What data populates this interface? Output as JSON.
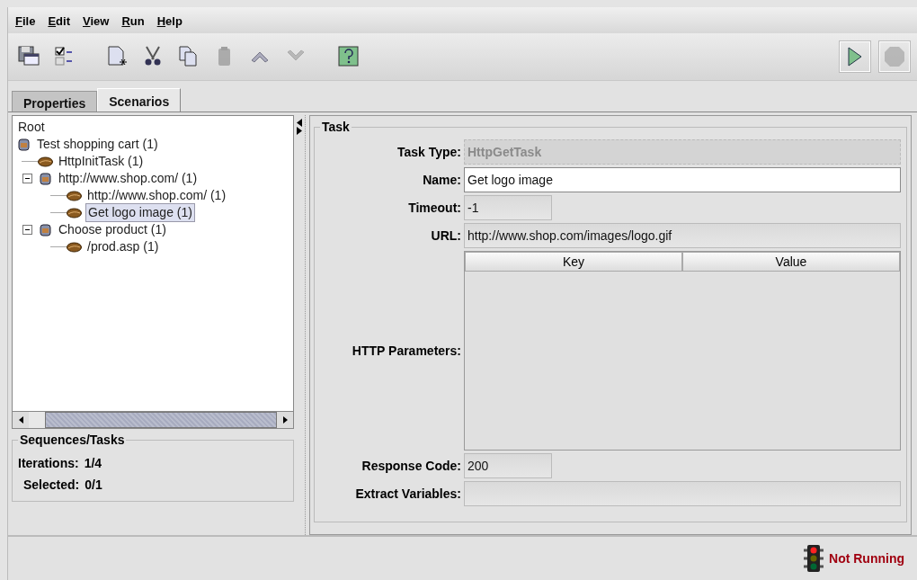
{
  "menu": [
    {
      "label": "File"
    },
    {
      "label": "Edit"
    },
    {
      "label": "View"
    },
    {
      "label": "Run"
    },
    {
      "label": "Help"
    }
  ],
  "toolbar": [
    {
      "kind": "save",
      "disabled": false
    },
    {
      "kind": "checklist",
      "disabled": false
    },
    {
      "kind": "sep"
    },
    {
      "kind": "new",
      "disabled": false
    },
    {
      "kind": "cut",
      "disabled": false
    },
    {
      "kind": "copy",
      "disabled": false
    },
    {
      "kind": "paste",
      "disabled": true
    },
    {
      "kind": "up",
      "disabled": false
    },
    {
      "kind": "down",
      "disabled": true
    },
    {
      "kind": "sep"
    },
    {
      "kind": "help",
      "disabled": false
    }
  ],
  "run_controls": [
    {
      "kind": "run",
      "disabled": false
    },
    {
      "kind": "stop",
      "disabled": true
    }
  ],
  "tabs": [
    {
      "label": "Properties",
      "selected": false
    },
    {
      "label": "Scenarios",
      "selected": true
    }
  ],
  "tree": {
    "root": "Root",
    "items": [
      {
        "label": "Test shopping cart (1)",
        "kind": "sequence",
        "selected": false,
        "children": [
          {
            "label": "HttpInitTask (1)",
            "kind": "task",
            "selected": false
          },
          {
            "label": "http://www.shop.com/ (1)",
            "kind": "sequence",
            "selected": false,
            "expanded": true,
            "children": [
              {
                "label": "http://www.shop.com/ (1)",
                "kind": "task",
                "selected": false
              },
              {
                "label": "Get logo image (1)",
                "kind": "task",
                "selected": true
              }
            ]
          },
          {
            "label": "Choose product (1)",
            "kind": "sequence",
            "selected": false,
            "expanded": true,
            "children": [
              {
                "label": "/prod.asp (1)",
                "kind": "task",
                "selected": false
              }
            ]
          }
        ]
      }
    ]
  },
  "sequences_panel": {
    "title": "Sequences/Tasks",
    "rows": [
      {
        "label": "Iterations:",
        "value": "1/4"
      },
      {
        "label": "Selected:",
        "value": "0/1"
      }
    ]
  },
  "task_panel": {
    "title": "Task",
    "fields": [
      {
        "label": "Task Type:",
        "kind": "text",
        "value": "HttpGetTask",
        "editable": false,
        "disabled": true
      },
      {
        "label": "Name:",
        "kind": "text",
        "value": "Get logo image",
        "editable": true,
        "disabled": false
      },
      {
        "label": "Timeout:",
        "kind": "short",
        "value": "-1",
        "editable": false,
        "disabled": false
      },
      {
        "label": "URL:",
        "kind": "text",
        "value": "http://www.shop.com/images/logo.gif",
        "editable": false,
        "disabled": false
      },
      {
        "label": "HTTP Parameters:",
        "kind": "table",
        "columns": [
          "Key",
          "Value"
        ]
      },
      {
        "label": "Response Code:",
        "kind": "short",
        "value": "200",
        "editable": false,
        "disabled": false
      },
      {
        "label": "Extract Variables:",
        "kind": "text",
        "editable": false,
        "disabled": false
      }
    ]
  },
  "status_bar": {
    "text": "Not Running",
    "running": false
  }
}
